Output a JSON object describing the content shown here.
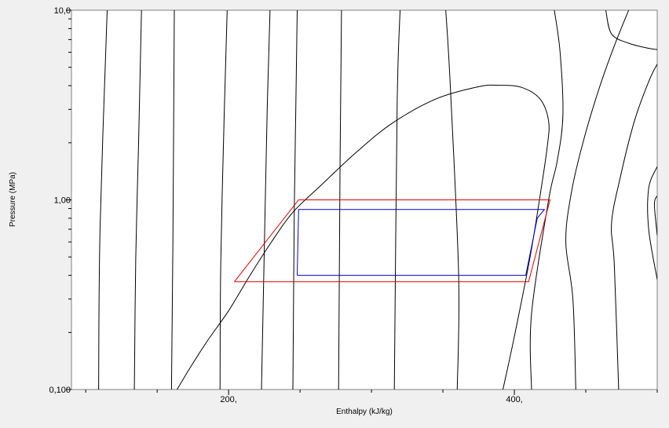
{
  "chart_data": {
    "type": "line",
    "title": "",
    "xlabel": "Enthalpy (kJ/kg)",
    "ylabel": "Pressure (MPa)",
    "xlim": [
      90,
      500
    ],
    "ylim": [
      0.1,
      10
    ],
    "yscale": "log",
    "x_ticks": [
      {
        "value": 200,
        "label": "200,"
      },
      {
        "value": 400,
        "label": "400,"
      }
    ],
    "y_ticks": [
      {
        "value": 0.1,
        "label": "0,100"
      },
      {
        "value": 1,
        "label": "1,00"
      },
      {
        "value": 10,
        "label": "10,0"
      }
    ],
    "grid": false,
    "legend": "none",
    "saturation_dome": {
      "color": "#000000",
      "points": [
        [
          163.9,
          0.1
        ],
        [
          173,
          0.13
        ],
        [
          185,
          0.18
        ],
        [
          200,
          0.26
        ],
        [
          215,
          0.4
        ],
        [
          230,
          0.6
        ],
        [
          245,
          0.86
        ],
        [
          265,
          1.2
        ],
        [
          290,
          1.8
        ],
        [
          315,
          2.55
        ],
        [
          345,
          3.4
        ],
        [
          375,
          3.95
        ],
        [
          390,
          4.02
        ],
        [
          405,
          3.92
        ],
        [
          418,
          3.4
        ],
        [
          424,
          2.6
        ],
        [
          423,
          1.9
        ],
        [
          418,
          1.05
        ],
        [
          411,
          0.5
        ],
        [
          400,
          0.19
        ],
        [
          392,
          0.1
        ]
      ]
    },
    "isotherm_lines": {
      "color": "#000000",
      "lines": [
        [
          [
            109,
            0.1
          ],
          [
            110,
            0.7
          ],
          [
            115,
            10
          ]
        ],
        [
          [
            134,
            0.1
          ],
          [
            135,
            0.5
          ],
          [
            137,
            2
          ],
          [
            139,
            10
          ]
        ],
        [
          [
            160,
            0.1
          ],
          [
            161,
            0.6
          ],
          [
            162,
            10
          ]
        ],
        [
          [
            194,
            0.1
          ],
          [
            194.5,
            0.45
          ],
          [
            197,
            3
          ],
          [
            199,
            10
          ]
        ],
        [
          [
            223,
            0.1
          ],
          [
            225,
            0.55
          ],
          [
            227,
            3
          ],
          [
            229,
            10
          ]
        ],
        [
          [
            245,
            0.1
          ],
          [
            246,
            0.9
          ],
          [
            247,
            3
          ],
          [
            248,
            10
          ]
        ],
        [
          [
            277,
            0.1
          ],
          [
            278,
            1.6
          ],
          [
            279,
            10
          ]
        ],
        [
          [
            316,
            0.1
          ],
          [
            318,
            3.2
          ],
          [
            320,
            10
          ]
        ],
        [
          [
            360,
            0.1
          ],
          [
            361,
            0.4
          ],
          [
            355,
            4.2
          ],
          [
            352,
            10
          ]
        ],
        [
          [
            412,
            0.1
          ],
          [
            412,
            0.25
          ],
          [
            424,
            1.0
          ],
          [
            430,
            1.6
          ],
          [
            434,
            2.8
          ],
          [
            432,
            6
          ],
          [
            428,
            10
          ]
        ],
        [
          [
            443,
            0.1
          ],
          [
            441,
            0.3
          ],
          [
            436,
            0.6
          ],
          [
            440,
            1.1
          ],
          [
            448,
            2.0
          ],
          [
            459,
            3.8
          ],
          [
            470,
            6.5
          ],
          [
            480,
            10
          ]
        ],
        [
          [
            473,
            0.1
          ],
          [
            470,
            0.45
          ],
          [
            468,
            0.75
          ],
          [
            474,
            1.3
          ],
          [
            484,
            2.6
          ],
          [
            494,
            4.2
          ],
          [
            500,
            5.2
          ]
        ],
        [
          [
            500,
            0.38
          ],
          [
            494,
            0.7
          ],
          [
            494,
            1.15
          ],
          [
            500,
            1.5
          ]
        ],
        [
          [
            500,
            0.65
          ],
          [
            498,
            0.95
          ],
          [
            500,
            1.05
          ]
        ],
        [
          [
            464,
            10
          ],
          [
            468,
            7.5
          ],
          [
            480,
            6.7
          ],
          [
            494,
            6.3
          ],
          [
            500,
            6.2
          ]
        ]
      ]
    },
    "series": [
      {
        "color": "#e00000",
        "x": [
          204,
          249,
          425,
          410,
          204
        ],
        "y": [
          0.37,
          1.0,
          1.0,
          0.37,
          0.37
        ]
      },
      {
        "color": "#0000c8",
        "x": [
          248,
          249,
          421,
          416,
          408,
          248
        ],
        "y": [
          0.4,
          0.89,
          0.89,
          0.8,
          0.4,
          0.4
        ]
      }
    ]
  }
}
